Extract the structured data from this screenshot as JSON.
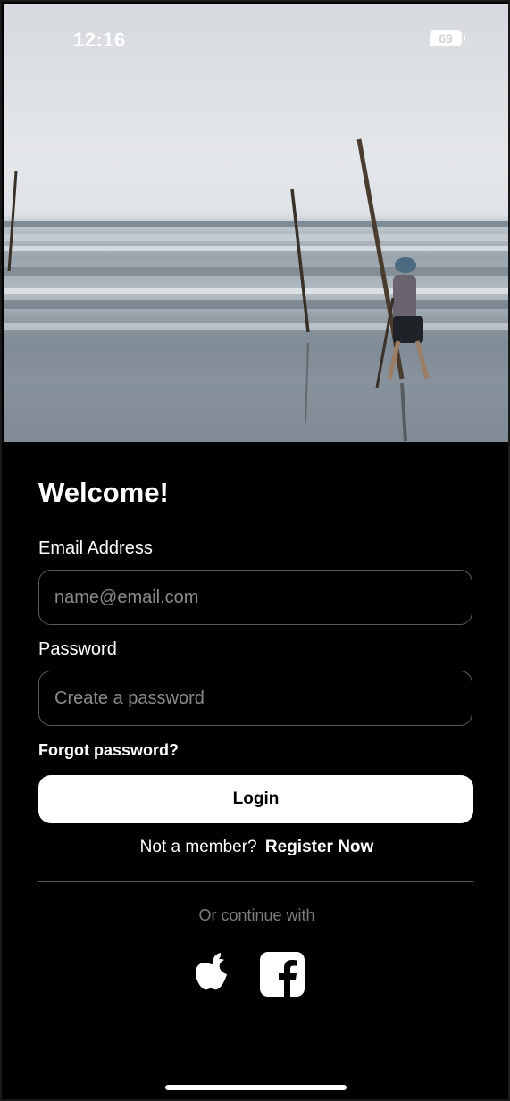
{
  "status_bar": {
    "time": "12:16",
    "battery": "69",
    "icons": [
      "signal-icon",
      "wifi-icon",
      "battery-icon"
    ]
  },
  "hero": {
    "icon": "beach-photo"
  },
  "form": {
    "title": "Welcome!",
    "email_label": "Email Address",
    "email_placeholder": "name@email.com",
    "email_value": "",
    "password_label": "Password",
    "password_placeholder": "Create a password",
    "password_value": "",
    "forgot_label": "Forgot password?",
    "login_label": "Login",
    "register_prompt": "Not a member?",
    "register_link": "Register Now"
  },
  "social": {
    "caption": "Or continue with",
    "providers": [
      "apple-icon",
      "facebook-icon"
    ]
  },
  "colors": {
    "background": "#000000",
    "primary_button": "#ffffff",
    "field_border": "#5a5a5c",
    "muted_text": "#7d7d80"
  }
}
